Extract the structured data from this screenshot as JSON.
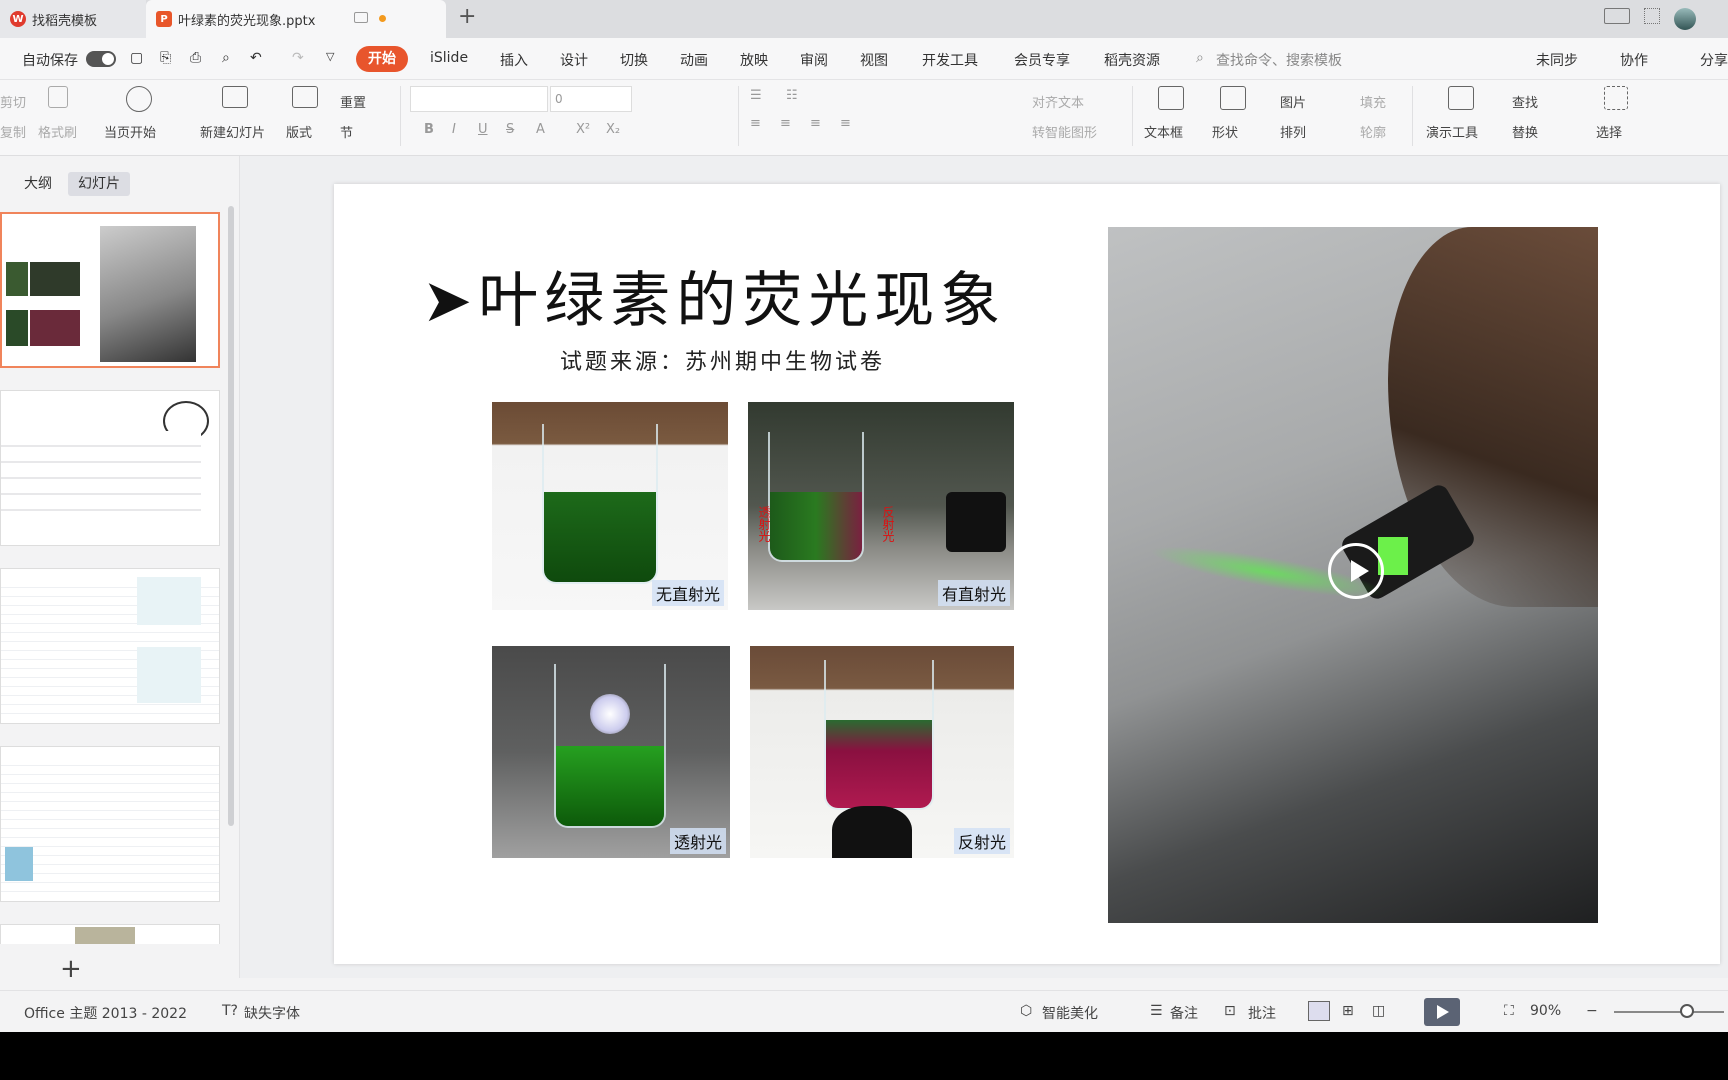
{
  "tabs": [
    {
      "label": "找稻壳模板",
      "icon": "wps-logo-icon"
    },
    {
      "label": "叶绿素的荧光现象.pptx",
      "icon": "presentation-file-icon"
    }
  ],
  "menu": {
    "autosave": "自动保存",
    "items": [
      "开始",
      "iSlide",
      "插入",
      "设计",
      "切换",
      "动画",
      "放映",
      "审阅",
      "视图",
      "开发工具",
      "会员专享",
      "稻壳资源"
    ],
    "search_placeholder": "查找命令、搜索模板",
    "right": [
      "未同步",
      "协作",
      "分享"
    ]
  },
  "ribbon": {
    "cut": "剪切",
    "copy": "复制",
    "format_painter": "格式刷",
    "from_current": "当页开始",
    "new_slide": "新建幻灯片",
    "layout": "版式",
    "reset": "重置",
    "section": "节",
    "font_size": "0",
    "align_text": "对齐文本",
    "smart_art": "转智能图形",
    "textbox": "文本框",
    "shape": "形状",
    "picture": "图片",
    "arrange": "排列",
    "fill": "填充",
    "outline": "轮廓",
    "presenter_tools": "演示工具",
    "find": "查找",
    "replace": "替换",
    "select": "选择"
  },
  "left_panel": {
    "tab_outline": "大纲",
    "tab_slides": "幻灯片"
  },
  "slide": {
    "title": "叶绿素的荧光现象",
    "subtitle": "试题来源：苏州期中生物试卷",
    "photos": [
      {
        "caption": "无直射光"
      },
      {
        "caption": "有直射光",
        "side_left": "透射光",
        "side_right": "反射光"
      },
      {
        "caption": "透射光"
      },
      {
        "caption": "反射光"
      }
    ]
  },
  "status": {
    "theme": "Office 主题 2013 - 2022",
    "missing_font": "缺失字体",
    "smart_beautify": "智能美化",
    "notes": "备注",
    "comments": "批注",
    "zoom": "90%"
  },
  "colors": {
    "accent": "#e8552c",
    "selected_thumb": "#f0845b"
  }
}
